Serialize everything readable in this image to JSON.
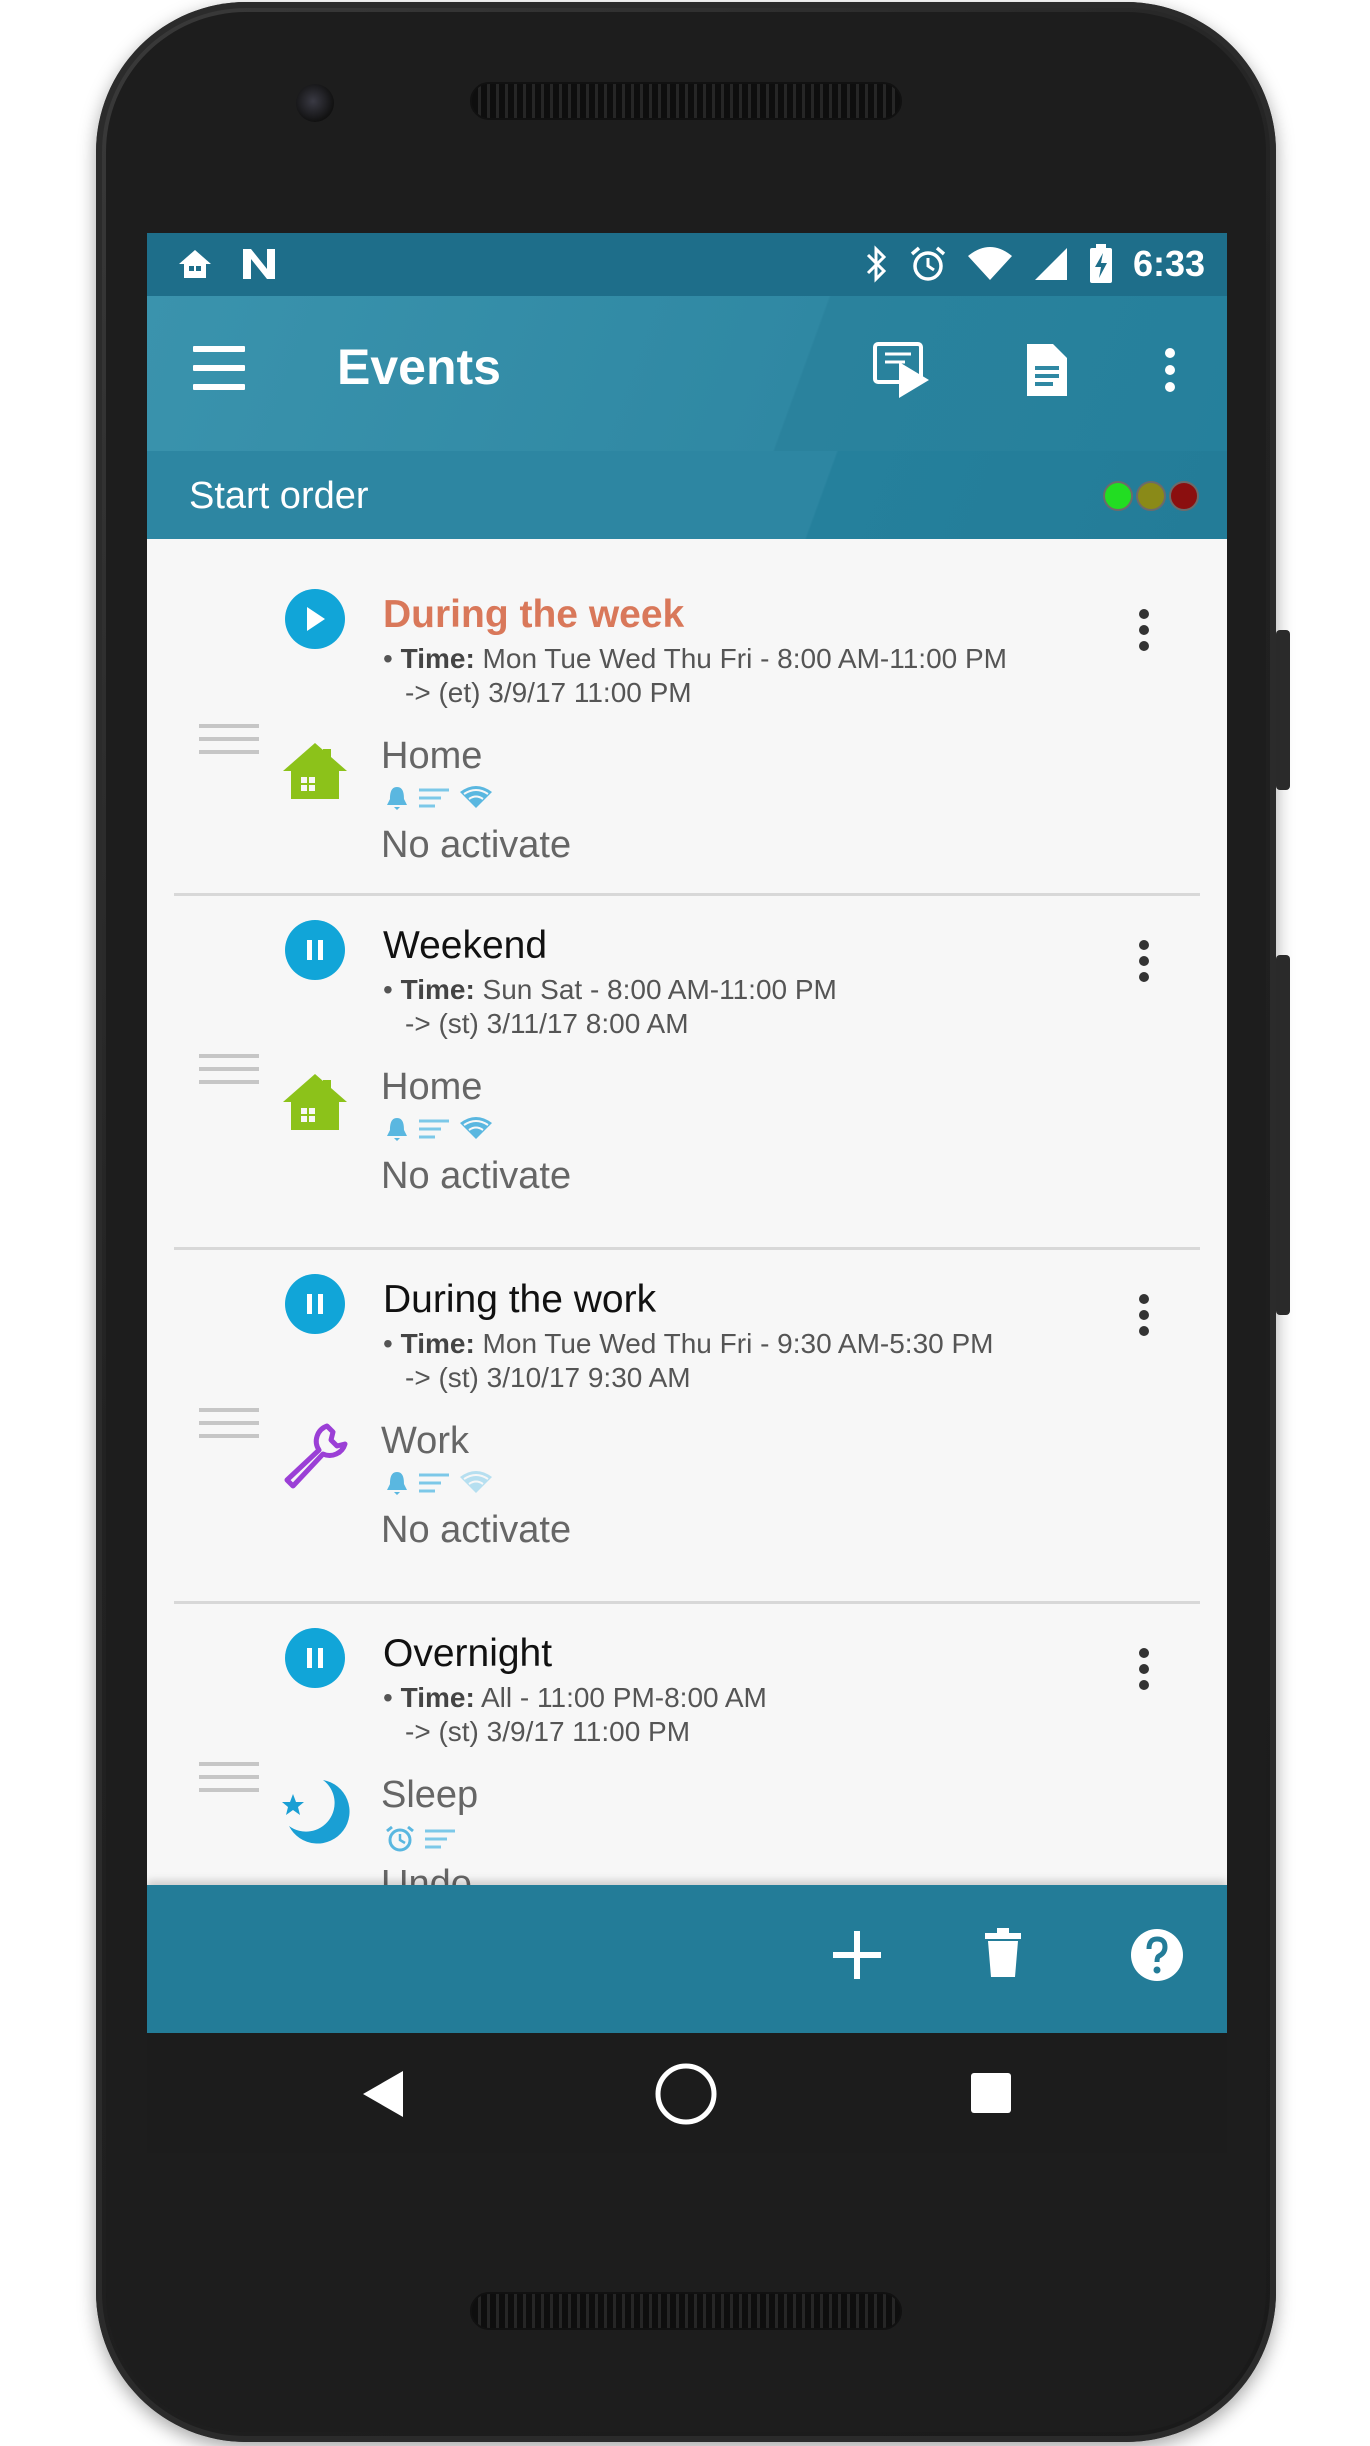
{
  "status_bar": {
    "time": "6:33",
    "left_icons": [
      "home-icon",
      "n-logo-icon"
    ],
    "right_icons": [
      "bluetooth-icon",
      "alarm-icon",
      "wifi-icon",
      "signal-icon",
      "battery-charging-icon"
    ]
  },
  "app_bar": {
    "title": "Events",
    "actions": [
      "run-events-icon",
      "activity-log-icon",
      "more-vert-icon"
    ]
  },
  "sub_bar": {
    "label": "Start order",
    "status_dots": [
      "#22dd22",
      "#8a8a18",
      "#8b0f0f"
    ]
  },
  "events": [
    {
      "name": "During the week",
      "status": "running",
      "time_label": "Time:",
      "time_value": " Mon Tue Wed Thu Fri - 8:00 AM-11:00 PM",
      "next": "-> (et) 3/9/17 11:00 PM",
      "profile": "Home",
      "profile_icon": "home-icon",
      "activation": "No activate"
    },
    {
      "name": "Weekend",
      "status": "paused",
      "time_label": "Time:",
      "time_value": " Sun Sat - 8:00 AM-11:00 PM",
      "next": "-> (st) 3/11/17 8:00 AM",
      "profile": "Home",
      "profile_icon": "home-icon",
      "activation": "No activate"
    },
    {
      "name": "During the work",
      "status": "paused",
      "time_label": "Time:",
      "time_value": " Mon Tue Wed Thu Fri - 9:30 AM-5:30 PM",
      "next": "-> (st) 3/10/17 9:30 AM",
      "profile": "Work",
      "profile_icon": "wrench-icon",
      "activation": "No activate"
    },
    {
      "name": "Overnight",
      "status": "paused",
      "time_label": "Time:",
      "time_value": " All - 11:00 PM-8:00 AM",
      "next": "-> (st) 3/9/17 11:00 PM",
      "profile": "Sleep",
      "profile_icon": "moon-icon",
      "activation": "Undo"
    }
  ],
  "bottom_bar": {
    "actions": [
      "add-icon",
      "delete-icon",
      "help-icon"
    ]
  },
  "nav_bar": {
    "buttons": [
      "back-icon",
      "home-circle-icon",
      "recents-icon"
    ]
  },
  "colors": {
    "primary": "#2f88a3",
    "primary_dark": "#1e6e8a",
    "accent": "#11a5d8",
    "running_event": "#d9785a",
    "home_icon": "#8cc21a",
    "work_icon": "#9b3fd6",
    "sleep_icon": "#1a9fd4"
  }
}
